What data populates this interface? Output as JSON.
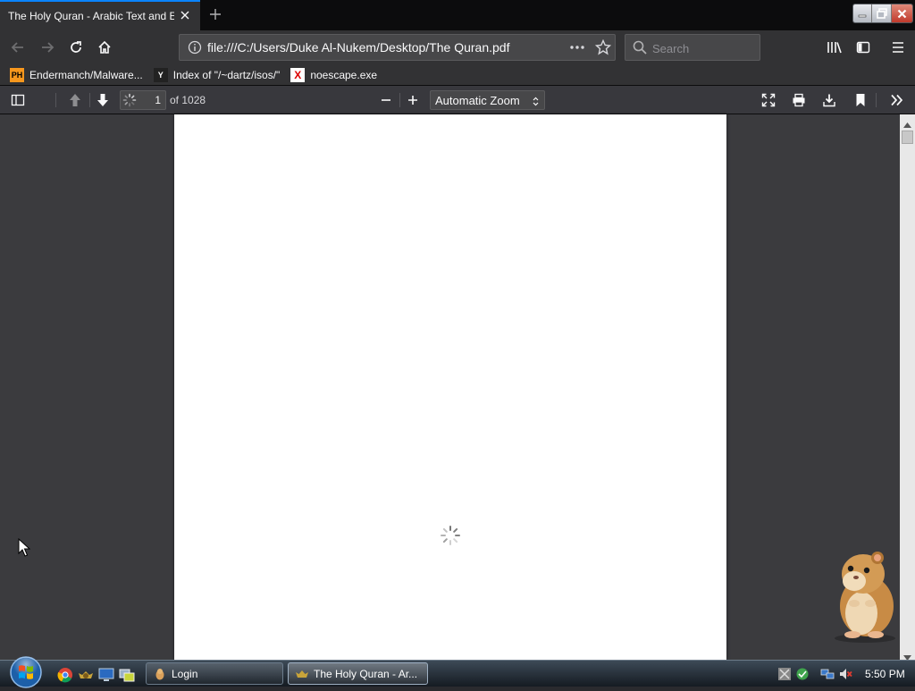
{
  "browser": {
    "tab": {
      "title": "The Holy Quran - Arabic Text and English Translation"
    },
    "url": "file:///C:/Users/Duke Al-Nukem/Desktop/The Quran.pdf",
    "search": {
      "placeholder": "Search"
    },
    "accent_color": "#0a84ff"
  },
  "bookmarks": [
    {
      "icon_text": "PH",
      "label": "Endermanch/Malware..."
    },
    {
      "icon_text": "Y",
      "label": "Index of \"/~dartz/isos/\""
    },
    {
      "icon_text": "X",
      "label": "noescape.exe"
    }
  ],
  "pdf": {
    "page_number": "1",
    "page_count": "of 1028",
    "zoom": "Automatic Zoom"
  },
  "taskbar": {
    "tasks": [
      {
        "label": "Login"
      },
      {
        "label": "The Holy Quran - Ar..."
      }
    ],
    "clock": "5:50 PM"
  }
}
